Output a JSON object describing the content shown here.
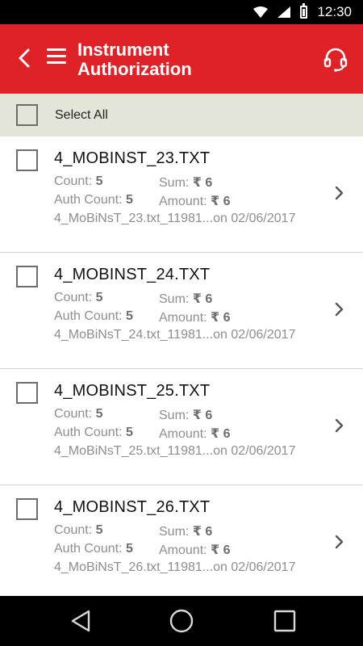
{
  "status_bar": {
    "time": "12:30"
  },
  "app_bar": {
    "title_line1": "Instrument",
    "title_line2": "Authorization",
    "back_icon": "chevron-left-icon",
    "menu_icon": "hamburger-menu-icon",
    "help_icon": "headset-support-icon"
  },
  "select_all": {
    "label": "Select All",
    "checked": false
  },
  "labels": {
    "count": "Count:",
    "sum": "Sum:",
    "auth_count": "Auth Count:",
    "amount": "Amount:"
  },
  "items": [
    {
      "name": "4_MOBINST_23.TXT",
      "count": "5",
      "sum": "₹ 6",
      "auth_count": "5",
      "amount": "₹ 6",
      "file_line": "4_MoBiNsT_23.txt_11981...on 02/06/2017"
    },
    {
      "name": "4_MOBINST_24.TXT",
      "count": "5",
      "sum": "₹ 6",
      "auth_count": "5",
      "amount": "₹ 6",
      "file_line": "4_MoBiNsT_24.txt_11981...on 02/06/2017"
    },
    {
      "name": "4_MOBINST_25.TXT",
      "count": "5",
      "sum": "₹ 6",
      "auth_count": "5",
      "amount": "₹ 6",
      "file_line": "4_MoBiNsT_25.txt_11981...on 02/06/2017"
    },
    {
      "name": "4_MOBINST_26.TXT",
      "count": "5",
      "sum": "₹ 6",
      "auth_count": "5",
      "amount": "₹ 6",
      "file_line": "4_MoBiNsT_26.txt_11981...on 02/06/2017"
    }
  ],
  "colors": {
    "app_bar": "#de2227",
    "select_all_bar": "#e4e5d9",
    "status_bar": "#000000",
    "nav_bar": "#000000"
  },
  "nav_bar": {
    "icons": [
      "nav-back-icon",
      "nav-home-icon",
      "nav-recents-icon"
    ]
  }
}
